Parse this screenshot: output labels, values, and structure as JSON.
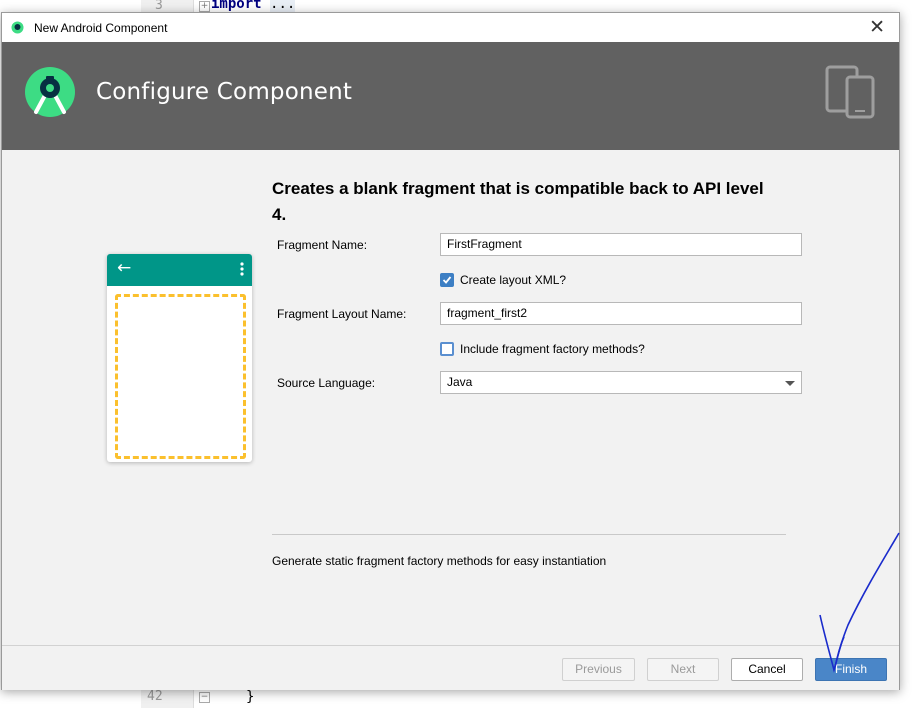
{
  "editor": {
    "line_top": "3",
    "code_top_keyword": "import",
    "code_top_fold": "...",
    "line_bottom": "42",
    "code_bottom": "}"
  },
  "dialog": {
    "window_title": "New Android Component",
    "close_glyph": "✕",
    "heading": "Configure Component",
    "description": "Creates a blank fragment that is compatible back to API level 4.",
    "fields": {
      "fragment_name_label": "Fragment Name:",
      "fragment_name_value": "FirstFragment",
      "create_layout_label": "Create layout XML?",
      "create_layout_checked": true,
      "layout_name_label": "Fragment Layout Name:",
      "layout_name_value": "fragment_first2",
      "factory_label": "Include fragment factory methods?",
      "factory_checked": false,
      "language_label": "Source Language:",
      "language_value": "Java"
    },
    "help_text": "Generate static fragment factory methods for easy instantiation",
    "buttons": {
      "previous": "Previous",
      "next": "Next",
      "cancel": "Cancel",
      "finish": "Finish"
    },
    "preview": {
      "back_glyph": "←"
    }
  },
  "colors": {
    "header_bg": "#616161",
    "preview_toolbar": "#009688",
    "preview_dashed": "#fbc02d",
    "android_green": "#3ddc84",
    "primary_button": "#4a86c8",
    "annotation_ink": "#1a2bcc"
  }
}
